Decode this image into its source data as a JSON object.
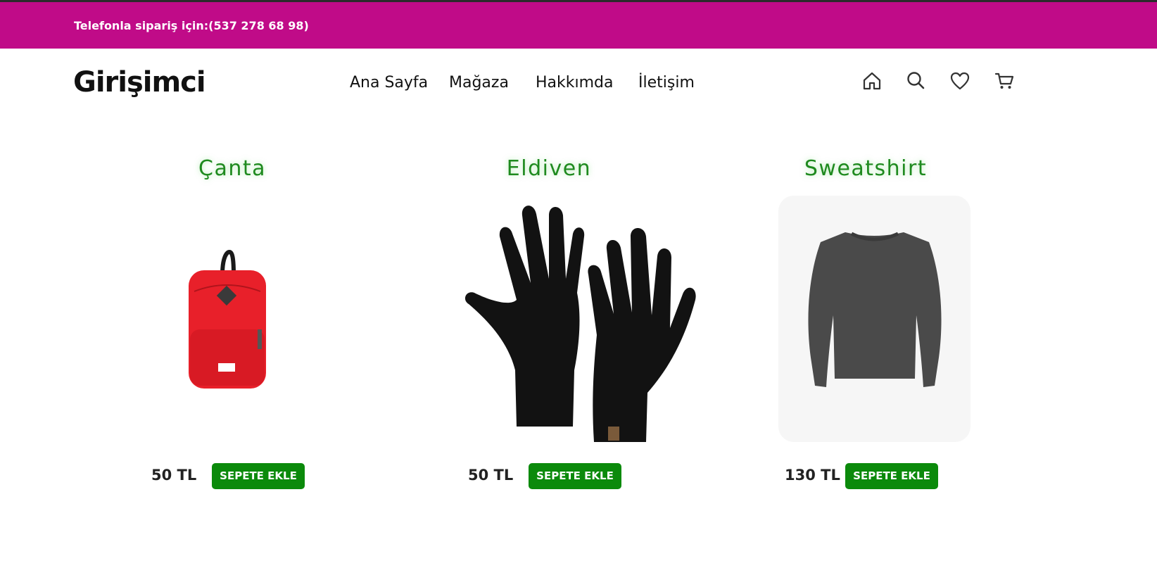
{
  "topbar": {
    "phone_text": "Telefonla sipariş için:(537 278 68 98)",
    "background": "#c00b88"
  },
  "header": {
    "logo": "Girişimci",
    "nav": [
      "Ana Sayfa",
      "Mağaza",
      "Hakkımda",
      "İletişim"
    ],
    "icons": [
      "home-icon",
      "search-icon",
      "heart-icon",
      "cart-icon"
    ]
  },
  "products": [
    {
      "title": "Çanta",
      "price": "50 TL",
      "button": "SEPETE EKLE",
      "image": "red-backpack"
    },
    {
      "title": "Eldiven",
      "price": "50 TL",
      "button": "SEPETE EKLE",
      "image": "black-knit-gloves"
    },
    {
      "title": "Sweatshirt",
      "price": "130 TL",
      "button": "SEPETE EKLE",
      "image": "gray-sweatshirt"
    }
  ],
  "colors": {
    "title_green": "#1f8a1f",
    "button_green": "#0b8a0b",
    "brand_magenta": "#c00b88"
  }
}
